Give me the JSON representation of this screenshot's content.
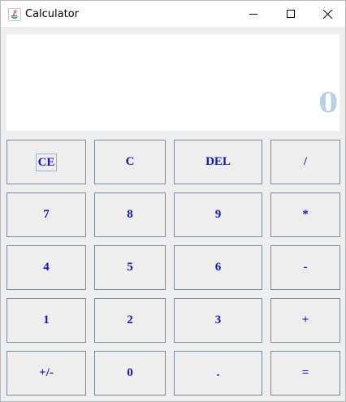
{
  "window": {
    "title": "Calculator",
    "icon": "java-cup-icon"
  },
  "controls": {
    "minimize": "minimize-icon",
    "maximize": "maximize-icon",
    "close": "close-icon"
  },
  "display": {
    "value": "0"
  },
  "keys": {
    "ce": "CE",
    "c": "C",
    "del": "DEL",
    "divide": "/",
    "seven": "7",
    "eight": "8",
    "nine": "9",
    "multiply": "*",
    "four": "4",
    "five": "5",
    "six": "6",
    "subtract": "-",
    "one": "1",
    "two": "2",
    "three": "3",
    "add": "+",
    "negate": "+/-",
    "zero": "0",
    "decimal": ".",
    "equals": "="
  },
  "colors": {
    "key_text": "#1515c8",
    "display_text": "#b8cfe4",
    "key_border": "#7a8a99",
    "key_face": "#eeeeee"
  }
}
